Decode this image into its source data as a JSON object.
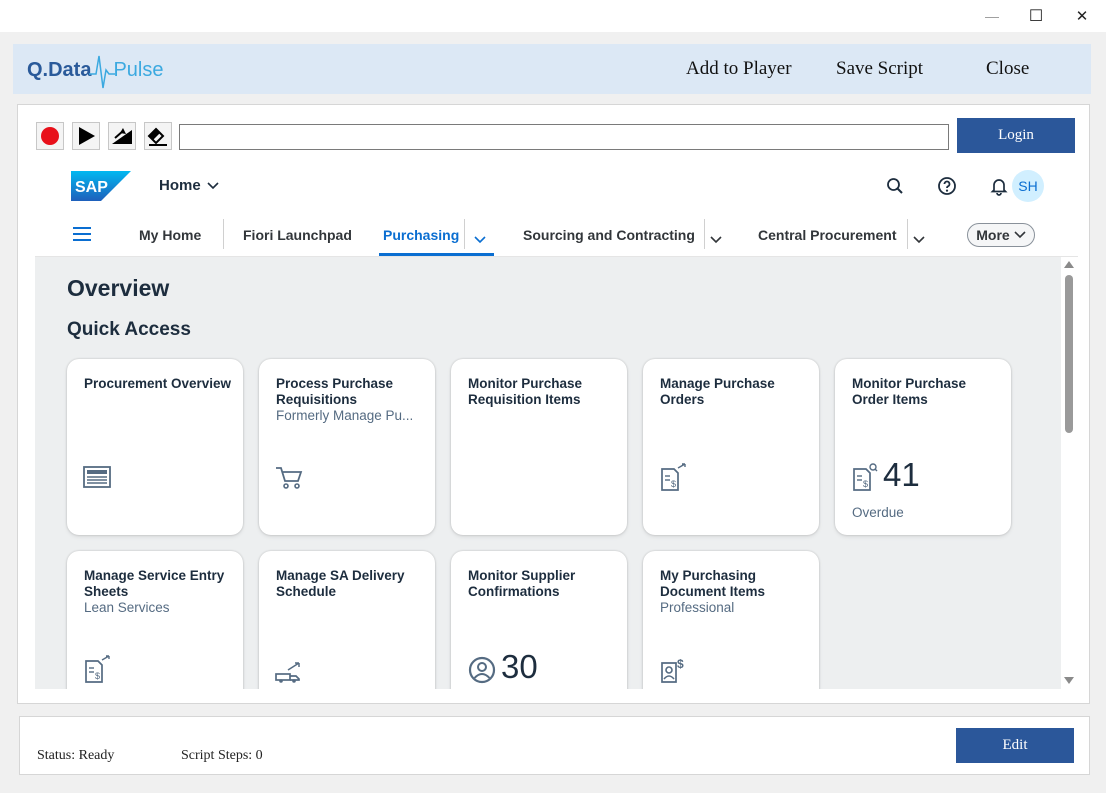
{
  "window": {
    "minimize_glyph": "—",
    "maximize_glyph": "☐",
    "close_glyph": "✕"
  },
  "app": {
    "logo_left": "Q.Data",
    "logo_right": "Pulse",
    "header_actions": [
      "Add to Player",
      "Save Script",
      "Close"
    ]
  },
  "toolbar": {
    "icons": [
      "record-icon",
      "play-icon",
      "step-icon",
      "eraser-icon"
    ],
    "url_value": "",
    "login_label": "Login"
  },
  "sap_shell": {
    "logo_text": "SAP",
    "home_label": "Home",
    "icons": [
      "search-icon",
      "help-icon",
      "notification-icon"
    ],
    "avatar_initials": "SH"
  },
  "nav": {
    "items": [
      "My Home",
      "Fiori Launchpad",
      "Purchasing",
      "Sourcing and Contracting",
      "Central Procurement"
    ],
    "active": "Purchasing",
    "more_label": "More"
  },
  "page": {
    "title": "Overview",
    "section": "Quick Access"
  },
  "tiles": [
    {
      "title": "Procurement Overview",
      "subtitle": "",
      "icon": "news-icon",
      "kpi": "",
      "footer": ""
    },
    {
      "title": "Process Purchase Requisitions",
      "subtitle": "Formerly Manage Pu...",
      "icon": "cart-icon",
      "kpi": "",
      "footer": ""
    },
    {
      "title": "Monitor Purchase Requisition Items",
      "subtitle": "",
      "icon": "",
      "kpi": "",
      "footer": ""
    },
    {
      "title": "Manage Purchase Orders",
      "subtitle": "",
      "icon": "purchase-document-icon",
      "kpi": "",
      "footer": ""
    },
    {
      "title": "Monitor Purchase Order Items",
      "subtitle": "",
      "icon": "order-search-icon",
      "kpi": "41",
      "footer": "Overdue"
    },
    {
      "title": "Manage Service Entry Sheets",
      "subtitle": "Lean Services",
      "icon": "service-document-icon",
      "kpi": "",
      "footer": ""
    },
    {
      "title": "Manage SA Delivery Schedule",
      "subtitle": "",
      "icon": "delivery-icon",
      "kpi": "",
      "footer": ""
    },
    {
      "title": "Monitor Supplier Confirmations",
      "subtitle": "",
      "icon": "supplier-icon",
      "kpi": "30",
      "footer": ""
    },
    {
      "title": "My Purchasing Document Items",
      "subtitle": "Professional",
      "icon": "buyer-icon",
      "kpi": "",
      "footer": ""
    }
  ],
  "status": {
    "status_text": "Status: Ready",
    "steps_text": "Script Steps: 0",
    "edit_label": "Edit"
  },
  "colors": {
    "header_band": "#dce8f5",
    "primary_button": "#2b579a",
    "sap_blue": "#0a6ed1",
    "content_bg": "#edeff0"
  }
}
